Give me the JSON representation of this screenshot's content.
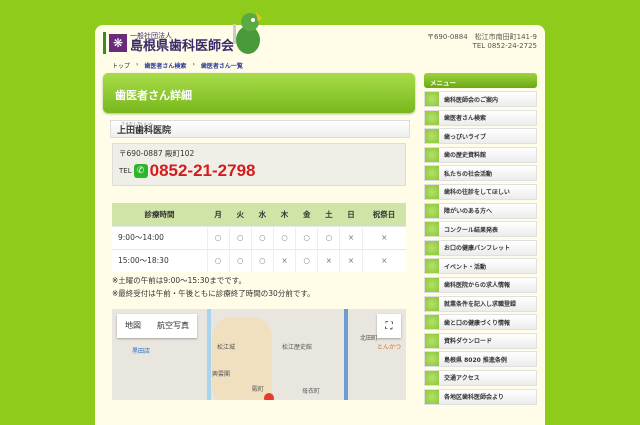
{
  "header": {
    "org_small": "一般社団法人",
    "org_name": "島根県歯科医師会",
    "logo_mark": "❋",
    "postal": "〒690-0884　松江市南田町141-9",
    "tel": "TEL 0852-24-2725"
  },
  "breadcrumb": [
    "トップ",
    "歯医者さん検索",
    "歯医者さん一覧"
  ],
  "breadcrumb_sep": "›",
  "page_title": "歯医者さん詳細",
  "clinic": {
    "ruby": "うえだしかいいん",
    "name": "上田歯科医院",
    "address": "〒690-0887 殿町102",
    "tel_label": "TEL",
    "tel": "0852-21-2798"
  },
  "hours": {
    "headers": [
      "診療時間",
      "月",
      "火",
      "水",
      "木",
      "金",
      "土",
      "日",
      "祝祭日"
    ],
    "rows": [
      [
        "9:00〜14:00",
        "○",
        "○",
        "○",
        "○",
        "○",
        "○",
        "×",
        "×"
      ],
      [
        "15:00〜18:30",
        "○",
        "○",
        "○",
        "×",
        "○",
        "×",
        "×",
        "×"
      ]
    ]
  },
  "notes": [
    "※土曜の午前は9:00〜15:30までです。",
    "※最終受付は午前・午後ともに診療終了時間の30分前です。"
  ],
  "map": {
    "tab_map": "地図",
    "tab_satellite": "航空写真",
    "fullscreen": "⛶",
    "labels": [
      "松江城",
      "松江歴史館",
      "興雲閣",
      "殿町",
      "母衣町",
      "北田町",
      "黒田店",
      "とんかつ"
    ]
  },
  "menu": {
    "title": "メニュー",
    "items": [
      "歯科医師会のご案内",
      "歯医者さん検索",
      "歯っぴいライブ",
      "歯の歴史資料館",
      "私たちの社会活動",
      "歯科の往診をしてほしい",
      "障がいのある方へ",
      "コンクール結果発表",
      "お口の健康パンフレット",
      "イベント・活動",
      "歯科医院からの求人情報",
      "就業条件を記入し求職登録",
      "歯と口の健康づくり情報",
      "資料ダウンロード",
      "島根県 8020 推進条例",
      "交通アクセス",
      "各地区歯科医師会より"
    ]
  }
}
